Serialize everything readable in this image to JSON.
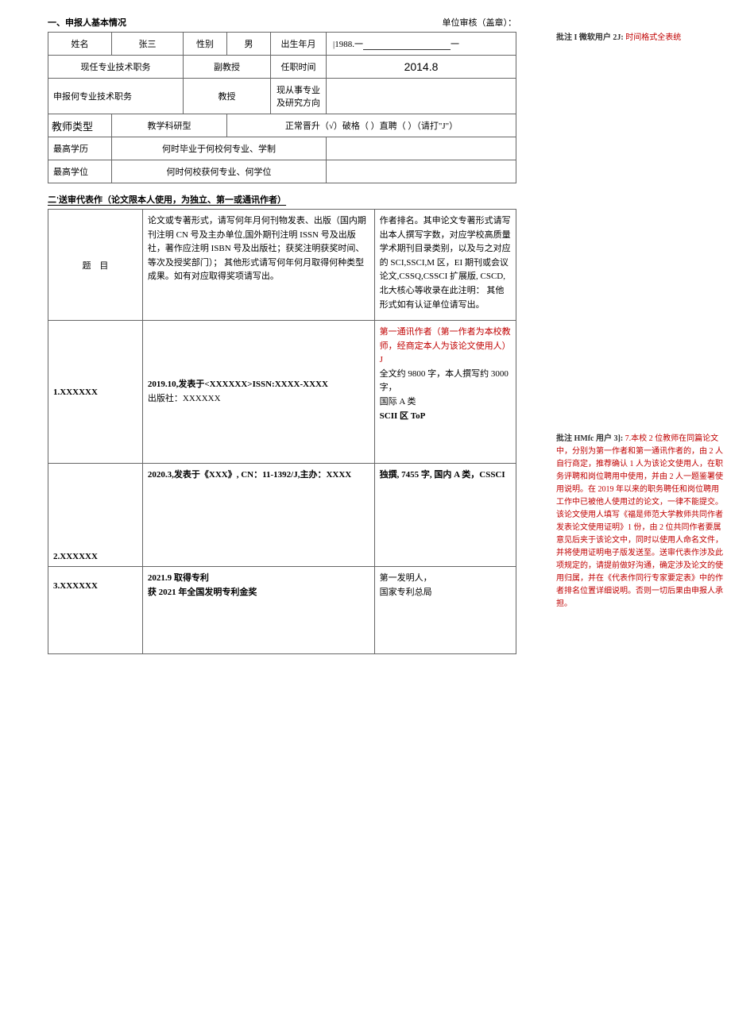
{
  "section1": {
    "title": "一、申报人基本情况",
    "stamp": "单位审核（盖章）：",
    "labels": {
      "name": "姓名",
      "name_val": "张三",
      "gender": "性别",
      "gender_val": "男",
      "dob": "出生年月",
      "dob_val": "|1988.一",
      "current_title": "现任专业技术职务",
      "current_title_val": "副教授",
      "appoint_time": "任职时间",
      "appoint_time_val": "2014.8",
      "apply_title": "申报何专业技术职务",
      "apply_title_val": "教授",
      "field": "现从事专业及研究方向",
      "teacher_type": "教师类型",
      "teacher_type_val": "教学科研型",
      "promotion": "正常晋升（√）破格（ ）直聘（ ）（请打\"J\"）",
      "highest_edu": "最高学历",
      "highest_edu_note": "何时毕业于何校何专业、学制",
      "highest_degree": "最高学位",
      "highest_degree_note": "何时何校获何专业、何学位"
    }
  },
  "section2": {
    "title": "二'送审代表作（论文限本人使用，为独立、第一或通讯作者）",
    "col1": "题　目",
    "col2": "论文或专著形式，请写何年月何刊物发表、出版（国内期刊注明 CN 号及主办单位,国外期刊注明 ISSN 号及出版社，著作应注明 ISBN 号及出版社；获奖注明获奖时间、等次及授奖部门）；\n其他形式请写何年何月取得何种类型成果。如有对应取得奖项请写出。",
    "col3": "作者排名。其申论文专著形式请写出本人撰写字数，对应学校高质量学术期刊目录类别，以及与之对应的 SCI,SSCI,M 区，EI 期刊或会议论文,CSSQ,CSSCI 扩展版, CSCD,北大核心等收录在此注明：\n其他形式如有认证单位请写出。",
    "rows": [
      {
        "title": "1.XXXXXX",
        "detail_a": "2019.10,发表于<XXXXXX>ISSN:XXXX-XXXX",
        "detail_b": "出版社：XXXXXX",
        "rank_a": "第一通讯作者（第一作者为本校教师，经商定本人为该论文使用人）J",
        "rank_b": "全文约 9800 字，本人撰写约 3000 字，",
        "rank_c": "国际 A 类",
        "rank_d": "SCII 区 ToP"
      },
      {
        "title": "2.XXXXXX",
        "detail_a": "2020.3,发表于《XXX》, CN：11-1392/J,主办：XXXX",
        "rank_a": "独撰, 7455 字, 国内 A 类，CSSCI"
      },
      {
        "title": "3.XXXXXX",
        "detail_a": "2021.9 取得专利",
        "detail_b": "获 2021 年全国发明专利金奖",
        "rank_a": "第一发明人，",
        "rank_b": "国家专利总局"
      }
    ]
  },
  "comments": {
    "c1_label": "批注 I 微软用户 2J:",
    "c1_text": "时间格式全表统",
    "c2_label": "批注 HMfc 用户 3]:",
    "c2_text": "7.本校 2 位教师在同篇论文中，分别为第一作者和第一通讯作者的，由 2 人自行商定，推荐确认 1 人为该论文使用人，在职务评聘和岗位聘用中使用，并由 2 人一题鉴署使用说明。在 2019 年以来的职务聘任和岗位聘用工作中已被他人使用过的论文，一律不能提交。该论文使用人填写《福是师范大学教师共同作者发表论文使用证明》1 份，由 2 位共同作者要属意见后夹于该论文中，同时以使用人命名文件，并将使用证明电子版发送至。送审代表作涉及此项规定的，请提前做好沟通，确定涉及论文的使用归属，并在《代表作同行专家要定表》中的作者排名位置详细说明。否则一切后果由申报人承担。"
  }
}
